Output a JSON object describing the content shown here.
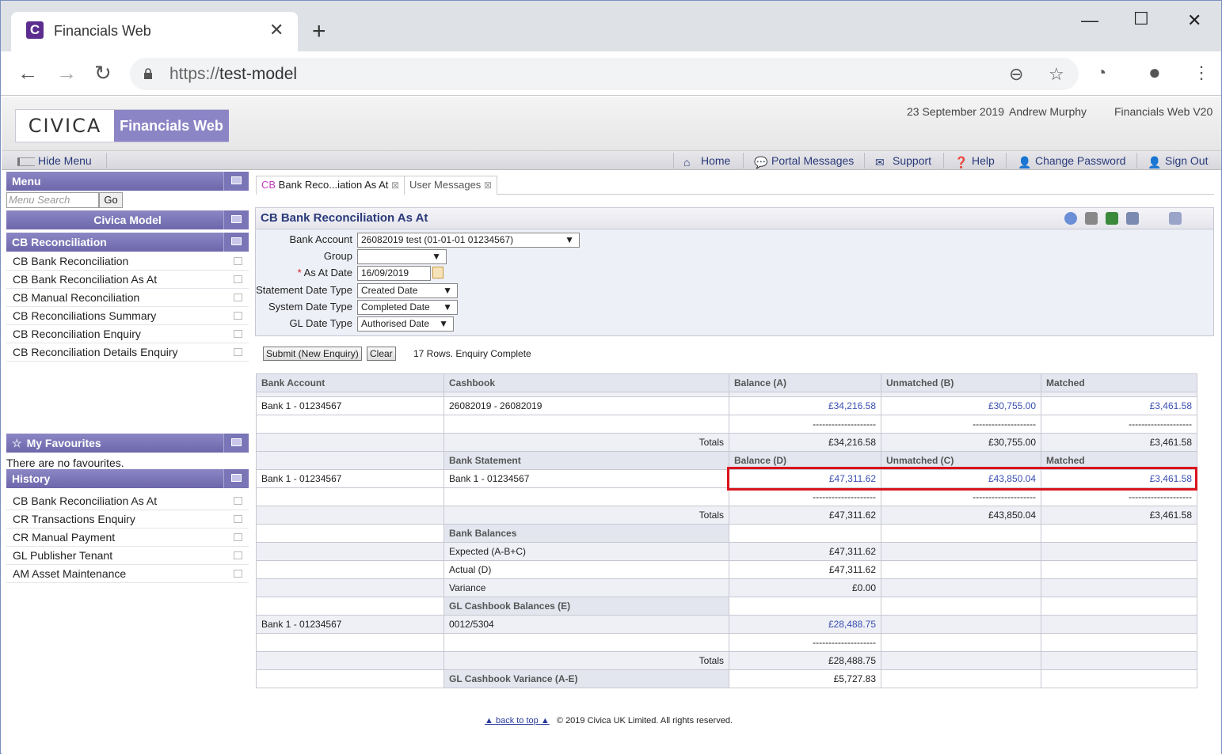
{
  "browser": {
    "tab_title": "Financials Web",
    "tab_favicon_letter": "C",
    "url_scheme": "https://",
    "url_host": "test-model"
  },
  "header": {
    "logo_civica": "CIVICA",
    "logo_product": "Financials Web",
    "date": "23 September 2019",
    "user": "Andrew Murphy",
    "version": "Financials Web V20"
  },
  "menubar": {
    "hide_menu": "Hide Menu",
    "items": [
      "Home",
      "Portal Messages",
      "Support",
      "Help",
      "Change Password",
      "Sign Out"
    ]
  },
  "sidebar": {
    "menu_title": "Menu",
    "search_placeholder": "Menu Search",
    "go_label": "Go",
    "model_title": "Civica Model",
    "section_title": "CB Reconciliation",
    "section_items": [
      "CB Bank Reconciliation",
      "CB Bank Reconciliation As At",
      "CB Manual Reconciliation",
      "CB Reconciliations Summary",
      "CB Reconciliation Enquiry",
      "CB Reconciliation Details Enquiry"
    ],
    "favourites_title": "My Favourites",
    "favourites_empty": "There are no favourites.",
    "history_title": "History",
    "history_items": [
      "CB Bank Reconciliation As At",
      "CR Transactions Enquiry",
      "CR Manual Payment",
      "GL Publisher Tenant",
      "AM Asset Maintenance"
    ]
  },
  "content": {
    "tabs": [
      {
        "prefix": "CB",
        "label": " Bank Reco...iation As At"
      },
      {
        "prefix": "",
        "label": "User Messages"
      }
    ],
    "panel_title": "CB Bank Reconciliation As At",
    "form": {
      "bank_account_label": "Bank Account",
      "bank_account_value": "26082019 test (01-01-01 01234567)",
      "group_label": "Group",
      "group_value": "",
      "required_mark": "*",
      "as_at_label": "As At Date",
      "as_at_value": "16/09/2019",
      "stmt_date_type_label": "Statement Date Type",
      "stmt_date_type_value": "Created Date",
      "sys_date_type_label": "System Date Type",
      "sys_date_type_value": "Completed Date",
      "gl_date_type_label": "GL Date Type",
      "gl_date_type_value": "Authorised Date"
    },
    "submit_label": "Submit (New Enquiry)",
    "clear_label": "Clear",
    "status_text": "17 Rows. Enquiry Complete",
    "table": {
      "headers": [
        "Bank Account",
        "Cashbook",
        "Balance (A)",
        "Unmatched (B)",
        "Matched"
      ],
      "row1": [
        "Bank 1 - 01234567",
        "26082019 - 26082019",
        "£34,216.58",
        "£30,755.00",
        "£3,461.58"
      ],
      "dashes": "--------------------",
      "totals_label": "Totals",
      "totals1": [
        "£34,216.58",
        "£30,755.00",
        "£3,461.58"
      ],
      "stmt_headers": [
        "Bank Statement",
        "Balance (D)",
        "Unmatched (C)",
        "Matched"
      ],
      "row2": [
        "Bank 1 - 01234567",
        "Bank 1 - 01234567",
        "£47,311.62",
        "£43,850.04",
        "£3,461.58"
      ],
      "totals2": [
        "£47,311.62",
        "£43,850.04",
        "£3,461.58"
      ],
      "bank_balances_label": "Bank Balances",
      "expected_label": "Expected (A-B+C)",
      "expected_value": "£47,311.62",
      "actual_label": "Actual (D)",
      "actual_value": "£47,311.62",
      "variance_label": "Variance",
      "variance_value": "£0.00",
      "gl_balances_label": "GL Cashbook Balances (E)",
      "row3": [
        "Bank 1 - 01234567",
        "0012/5304",
        "£28,488.75"
      ],
      "totals3": "£28,488.75",
      "gl_variance_label": "GL Cashbook Variance (A-E)",
      "gl_variance_value": "£5,727.83"
    }
  },
  "footer": {
    "back_to_top": "back to top",
    "copyright": "© 2019 Civica UK Limited. All rights reserved."
  },
  "colors": {
    "accent": "#6d67ab",
    "link": "#3a4fb0",
    "highlight": "#d9141e"
  }
}
